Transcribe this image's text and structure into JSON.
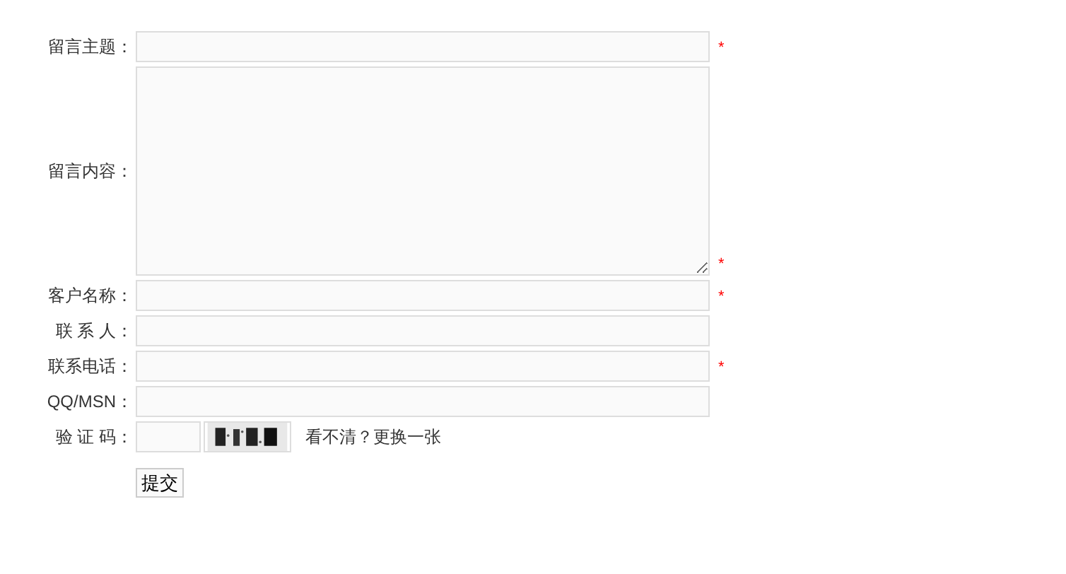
{
  "fields": [
    {
      "label": "留言主题：",
      "kind": "input",
      "required_mark": "*"
    },
    {
      "label": "留言内容：",
      "kind": "textarea",
      "required_mark": "*"
    },
    {
      "label": "客户名称：",
      "kind": "input",
      "required_mark": "*"
    },
    {
      "label": "联 系 人：",
      "kind": "input"
    },
    {
      "label": "联系电话：",
      "kind": "input",
      "required_mark": "*"
    },
    {
      "label": "QQ/MSN：",
      "kind": "input"
    },
    {
      "label": "验 证 码：",
      "kind": "captcha",
      "refresh_link": "看不清？更换一张"
    }
  ],
  "submit_button": "提交"
}
